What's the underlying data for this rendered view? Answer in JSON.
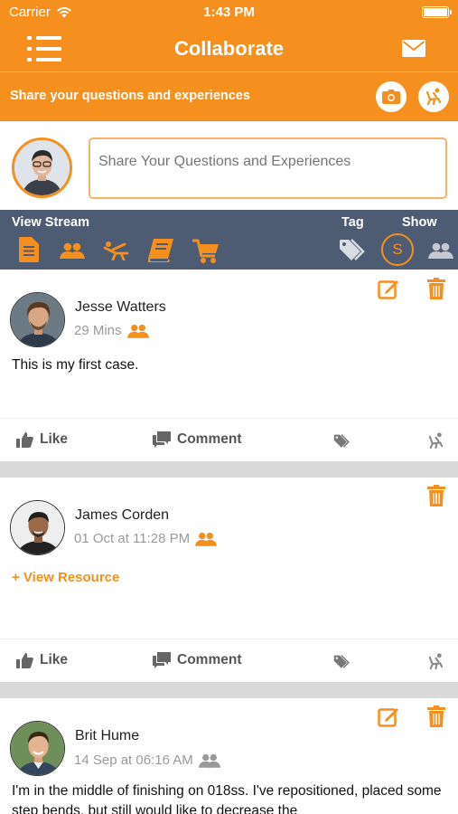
{
  "status": {
    "carrier": "Carrier",
    "time": "1:43 PM"
  },
  "nav": {
    "title": "Collaborate"
  },
  "share_bar": {
    "label": "Share your questions and experiences"
  },
  "composer": {
    "placeholder": "Share Your Questions and Experiences"
  },
  "filter_bar": {
    "view_stream": "View Stream",
    "tag": "Tag",
    "show": "Show",
    "show_value": "S"
  },
  "actions": {
    "like": "Like",
    "comment": "Comment"
  },
  "posts": [
    {
      "name": "Jesse Watters",
      "time": "29 Mins",
      "text": "This is my first case."
    },
    {
      "name": "James Corden",
      "time": "01 Oct at 11:28 PM",
      "link": "+ View Resource"
    },
    {
      "name": "Brit Hume",
      "time": "14 Sep at 06:16 AM",
      "text": "I'm in the middle of finishing on 018ss.  I've repositioned, placed some step bends, but still would like to decrease the"
    }
  ],
  "colors": {
    "accent": "#f5901e",
    "filter_bg": "#4d5b73",
    "gray_icon": "#888888"
  }
}
